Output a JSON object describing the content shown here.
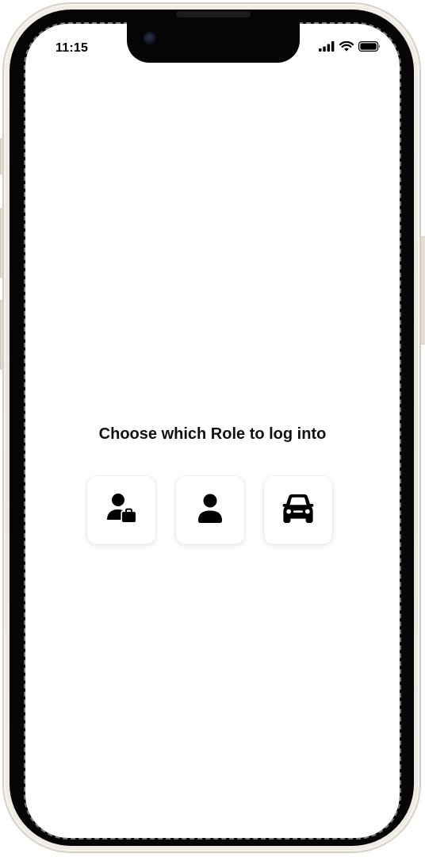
{
  "status_bar": {
    "time": "11:15",
    "icons": [
      "signal-icon",
      "wifi-icon",
      "battery-icon"
    ]
  },
  "main": {
    "title": "Choose which Role to log into",
    "roles": [
      {
        "icon": "business-person-icon"
      },
      {
        "icon": "person-icon"
      },
      {
        "icon": "car-icon"
      }
    ]
  },
  "colors": {
    "text": "#111111",
    "frame": "#ece7df",
    "bezel": "#050505",
    "screen": "#ffffff"
  }
}
